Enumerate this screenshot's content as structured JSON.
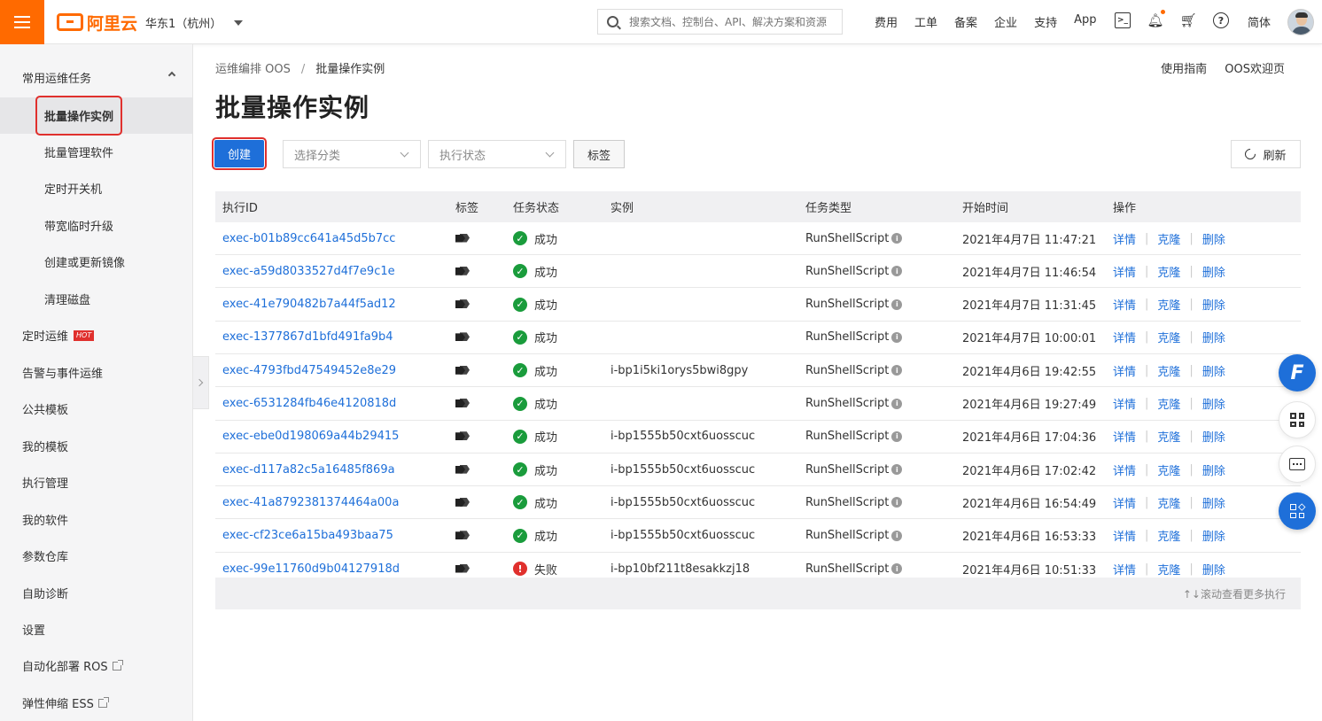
{
  "topbar": {
    "logo_text": "阿里云",
    "region": "华东1（杭州）",
    "search_placeholder": "搜索文档、控制台、API、解决方案和资源",
    "links": [
      "费用",
      "工单",
      "备案",
      "企业",
      "支持",
      "App"
    ],
    "lang": "简体",
    "accent": "#ff6a00"
  },
  "sidebar": {
    "group_title": "常用运维任务",
    "sub_items": [
      "批量操作实例",
      "批量管理软件",
      "定时开关机",
      "带宽临时升级",
      "创建或更新镜像",
      "清理磁盘"
    ],
    "active_index": 0,
    "items": [
      {
        "label": "定时运维",
        "badge": "HOT"
      },
      {
        "label": "告警与事件运维"
      },
      {
        "label": "公共模板"
      },
      {
        "label": "我的模板"
      },
      {
        "label": "执行管理"
      },
      {
        "label": "我的软件"
      },
      {
        "label": "参数仓库"
      },
      {
        "label": "自助诊断"
      },
      {
        "label": "设置"
      },
      {
        "label": "自动化部署 ROS",
        "external": true
      },
      {
        "label": "弹性伸缩 ESS",
        "external": true
      }
    ]
  },
  "breadcrumb": {
    "parent": "运维编排 OOS",
    "sep": "/",
    "current": "批量操作实例"
  },
  "head_links": [
    "使用指南",
    "OOS欢迎页"
  ],
  "page_title": "批量操作实例",
  "toolbar": {
    "create_label": "创建",
    "category_placeholder": "选择分类",
    "status_placeholder": "执行状态",
    "tag_label": "标签",
    "refresh_label": "刷新"
  },
  "table": {
    "columns": [
      "执行ID",
      "标签",
      "任务状态",
      "实例",
      "任务类型",
      "开始时间",
      "操作"
    ],
    "actions": [
      "详情",
      "克隆",
      "删除"
    ],
    "rows": [
      {
        "id": "exec-b01b89cc641a45d5b7cc",
        "status": "成功",
        "ok": true,
        "instance": "",
        "type": "RunShellScript",
        "time": "2021年4月7日 11:47:21"
      },
      {
        "id": "exec-a59d8033527d4f7e9c1e",
        "status": "成功",
        "ok": true,
        "instance": "",
        "type": "RunShellScript",
        "time": "2021年4月7日 11:46:54"
      },
      {
        "id": "exec-41e790482b7a44f5ad12",
        "status": "成功",
        "ok": true,
        "instance": "",
        "type": "RunShellScript",
        "time": "2021年4月7日 11:31:45"
      },
      {
        "id": "exec-1377867d1bfd491fa9b4",
        "status": "成功",
        "ok": true,
        "instance": "",
        "type": "RunShellScript",
        "time": "2021年4月7日 10:00:01"
      },
      {
        "id": "exec-4793fbd47549452e8e29",
        "status": "成功",
        "ok": true,
        "instance": "i-bp1i5ki1orys5bwi8gpy",
        "type": "RunShellScript",
        "time": "2021年4月6日 19:42:55"
      },
      {
        "id": "exec-6531284fb46e4120818d",
        "status": "成功",
        "ok": true,
        "instance": "",
        "type": "RunShellScript",
        "time": "2021年4月6日 19:27:49"
      },
      {
        "id": "exec-ebe0d198069a44b29415",
        "status": "成功",
        "ok": true,
        "instance": "i-bp1555b50cxt6uosscuc",
        "type": "RunShellScript",
        "time": "2021年4月6日 17:04:36"
      },
      {
        "id": "exec-d117a82c5a16485f869a",
        "status": "成功",
        "ok": true,
        "instance": "i-bp1555b50cxt6uosscuc",
        "type": "RunShellScript",
        "time": "2021年4月6日 17:02:42"
      },
      {
        "id": "exec-41a8792381374464a00a",
        "status": "成功",
        "ok": true,
        "instance": "i-bp1555b50cxt6uosscuc",
        "type": "RunShellScript",
        "time": "2021年4月6日 16:54:49"
      },
      {
        "id": "exec-cf23ce6a15ba493baa75",
        "status": "成功",
        "ok": true,
        "instance": "i-bp1555b50cxt6uosscuc",
        "type": "RunShellScript",
        "time": "2021年4月6日 16:53:33"
      },
      {
        "id": "exec-99e11760d9b04127918d",
        "status": "失败",
        "ok": false,
        "instance": "i-bp10bf211t8esakkzj18",
        "type": "RunShellScript",
        "time": "2021年4月6日 10:51:33"
      }
    ],
    "scroll_hint": "↑↓滚动查看更多执行"
  },
  "colors": {
    "primary": "#1e6fd9",
    "success": "#1a9c3c",
    "danger": "#e0302d"
  }
}
